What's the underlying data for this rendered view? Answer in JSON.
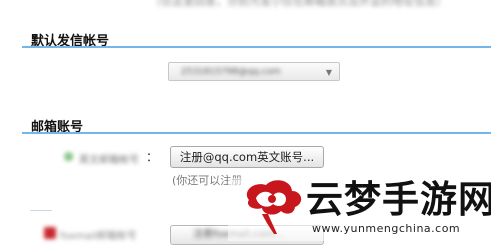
{
  "top_hint": "（仅这里回答，分别为发小仅在邮箱首页及外显的地址信息）",
  "sections": {
    "default_sender": {
      "title": "默认发信帐号",
      "select_value": "2531815798@qq.com"
    },
    "mailbox_account": {
      "title": "邮箱账号",
      "account_label": "英文邮箱帐号",
      "colon": "：",
      "register_button": "注册@qq.com英文账号...",
      "note": "(你还可以注册"
    }
  },
  "bottom_row": {
    "label": "foxmail邮箱帐号",
    "button_label": "注册foxmail.com..."
  },
  "watermark": {
    "name": "云梦手游网",
    "url": "www.yunmengchina.com",
    "colors": {
      "logo_red": "#c8161d",
      "text": "#111111"
    }
  },
  "colors": {
    "section_line": "#74b6e8",
    "accent_red": "#c8282c"
  }
}
